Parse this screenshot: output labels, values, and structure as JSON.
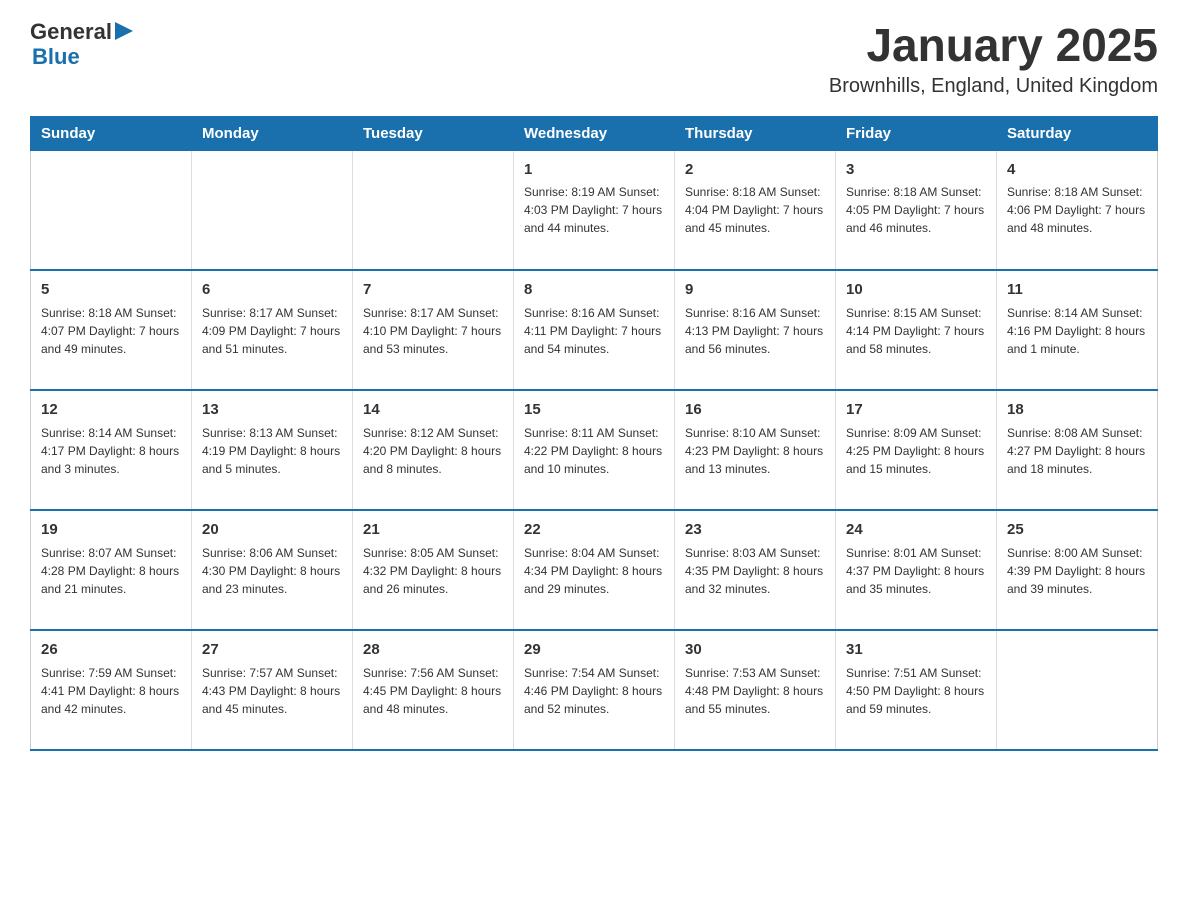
{
  "header": {
    "logo": {
      "general": "General",
      "blue": "Blue"
    },
    "title": "January 2025",
    "subtitle": "Brownhills, England, United Kingdom"
  },
  "days_of_week": [
    "Sunday",
    "Monday",
    "Tuesday",
    "Wednesday",
    "Thursday",
    "Friday",
    "Saturday"
  ],
  "weeks": [
    [
      {
        "day": "",
        "info": ""
      },
      {
        "day": "",
        "info": ""
      },
      {
        "day": "",
        "info": ""
      },
      {
        "day": "1",
        "info": "Sunrise: 8:19 AM\nSunset: 4:03 PM\nDaylight: 7 hours\nand 44 minutes."
      },
      {
        "day": "2",
        "info": "Sunrise: 8:18 AM\nSunset: 4:04 PM\nDaylight: 7 hours\nand 45 minutes."
      },
      {
        "day": "3",
        "info": "Sunrise: 8:18 AM\nSunset: 4:05 PM\nDaylight: 7 hours\nand 46 minutes."
      },
      {
        "day": "4",
        "info": "Sunrise: 8:18 AM\nSunset: 4:06 PM\nDaylight: 7 hours\nand 48 minutes."
      }
    ],
    [
      {
        "day": "5",
        "info": "Sunrise: 8:18 AM\nSunset: 4:07 PM\nDaylight: 7 hours\nand 49 minutes."
      },
      {
        "day": "6",
        "info": "Sunrise: 8:17 AM\nSunset: 4:09 PM\nDaylight: 7 hours\nand 51 minutes."
      },
      {
        "day": "7",
        "info": "Sunrise: 8:17 AM\nSunset: 4:10 PM\nDaylight: 7 hours\nand 53 minutes."
      },
      {
        "day": "8",
        "info": "Sunrise: 8:16 AM\nSunset: 4:11 PM\nDaylight: 7 hours\nand 54 minutes."
      },
      {
        "day": "9",
        "info": "Sunrise: 8:16 AM\nSunset: 4:13 PM\nDaylight: 7 hours\nand 56 minutes."
      },
      {
        "day": "10",
        "info": "Sunrise: 8:15 AM\nSunset: 4:14 PM\nDaylight: 7 hours\nand 58 minutes."
      },
      {
        "day": "11",
        "info": "Sunrise: 8:14 AM\nSunset: 4:16 PM\nDaylight: 8 hours\nand 1 minute."
      }
    ],
    [
      {
        "day": "12",
        "info": "Sunrise: 8:14 AM\nSunset: 4:17 PM\nDaylight: 8 hours\nand 3 minutes."
      },
      {
        "day": "13",
        "info": "Sunrise: 8:13 AM\nSunset: 4:19 PM\nDaylight: 8 hours\nand 5 minutes."
      },
      {
        "day": "14",
        "info": "Sunrise: 8:12 AM\nSunset: 4:20 PM\nDaylight: 8 hours\nand 8 minutes."
      },
      {
        "day": "15",
        "info": "Sunrise: 8:11 AM\nSunset: 4:22 PM\nDaylight: 8 hours\nand 10 minutes."
      },
      {
        "day": "16",
        "info": "Sunrise: 8:10 AM\nSunset: 4:23 PM\nDaylight: 8 hours\nand 13 minutes."
      },
      {
        "day": "17",
        "info": "Sunrise: 8:09 AM\nSunset: 4:25 PM\nDaylight: 8 hours\nand 15 minutes."
      },
      {
        "day": "18",
        "info": "Sunrise: 8:08 AM\nSunset: 4:27 PM\nDaylight: 8 hours\nand 18 minutes."
      }
    ],
    [
      {
        "day": "19",
        "info": "Sunrise: 8:07 AM\nSunset: 4:28 PM\nDaylight: 8 hours\nand 21 minutes."
      },
      {
        "day": "20",
        "info": "Sunrise: 8:06 AM\nSunset: 4:30 PM\nDaylight: 8 hours\nand 23 minutes."
      },
      {
        "day": "21",
        "info": "Sunrise: 8:05 AM\nSunset: 4:32 PM\nDaylight: 8 hours\nand 26 minutes."
      },
      {
        "day": "22",
        "info": "Sunrise: 8:04 AM\nSunset: 4:34 PM\nDaylight: 8 hours\nand 29 minutes."
      },
      {
        "day": "23",
        "info": "Sunrise: 8:03 AM\nSunset: 4:35 PM\nDaylight: 8 hours\nand 32 minutes."
      },
      {
        "day": "24",
        "info": "Sunrise: 8:01 AM\nSunset: 4:37 PM\nDaylight: 8 hours\nand 35 minutes."
      },
      {
        "day": "25",
        "info": "Sunrise: 8:00 AM\nSunset: 4:39 PM\nDaylight: 8 hours\nand 39 minutes."
      }
    ],
    [
      {
        "day": "26",
        "info": "Sunrise: 7:59 AM\nSunset: 4:41 PM\nDaylight: 8 hours\nand 42 minutes."
      },
      {
        "day": "27",
        "info": "Sunrise: 7:57 AM\nSunset: 4:43 PM\nDaylight: 8 hours\nand 45 minutes."
      },
      {
        "day": "28",
        "info": "Sunrise: 7:56 AM\nSunset: 4:45 PM\nDaylight: 8 hours\nand 48 minutes."
      },
      {
        "day": "29",
        "info": "Sunrise: 7:54 AM\nSunset: 4:46 PM\nDaylight: 8 hours\nand 52 minutes."
      },
      {
        "day": "30",
        "info": "Sunrise: 7:53 AM\nSunset: 4:48 PM\nDaylight: 8 hours\nand 55 minutes."
      },
      {
        "day": "31",
        "info": "Sunrise: 7:51 AM\nSunset: 4:50 PM\nDaylight: 8 hours\nand 59 minutes."
      },
      {
        "day": "",
        "info": ""
      }
    ]
  ]
}
